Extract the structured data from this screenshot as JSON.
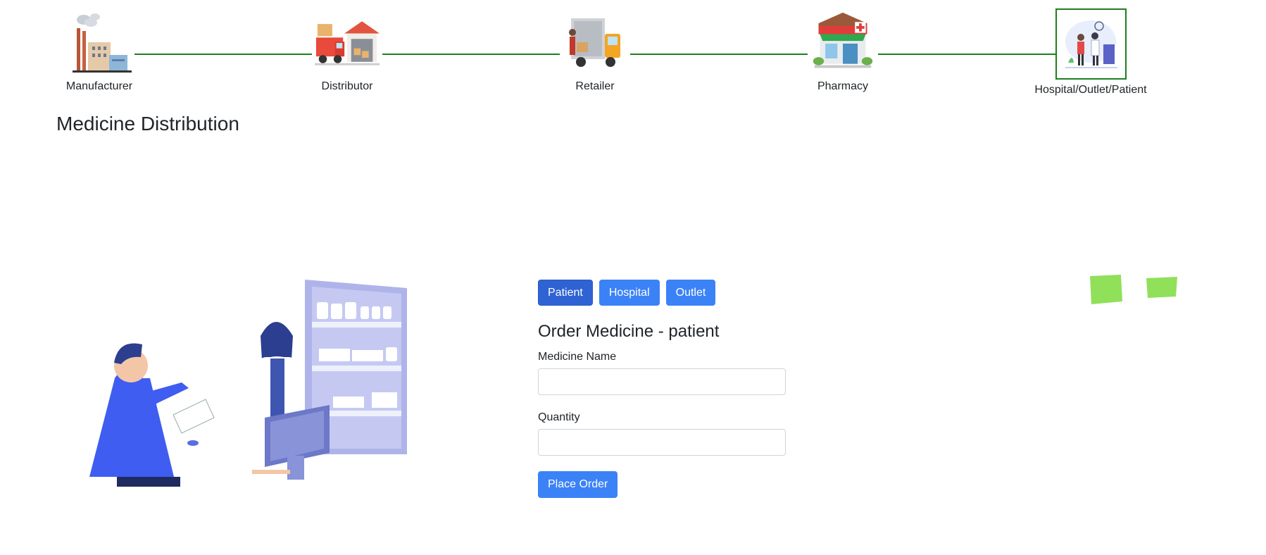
{
  "stepper": {
    "steps": [
      {
        "label": "Manufacturer",
        "icon": "factory-icon"
      },
      {
        "label": "Distributor",
        "icon": "warehouse-truck-icon"
      },
      {
        "label": "Retailer",
        "icon": "delivery-van-icon"
      },
      {
        "label": "Pharmacy",
        "icon": "pharmacy-store-icon"
      },
      {
        "label": "Hospital/Outlet/Patient",
        "icon": "hospital-patient-icon"
      }
    ],
    "active_index": 4,
    "line_color": "#1e7e1e"
  },
  "page": {
    "title": "Medicine Distribution"
  },
  "tabs": [
    {
      "label": "Patient",
      "active": true
    },
    {
      "label": "Hospital",
      "active": false
    },
    {
      "label": "Outlet",
      "active": false
    }
  ],
  "form": {
    "title": "Order Medicine - patient",
    "medicine_name": {
      "label": "Medicine Name",
      "value": "",
      "placeholder": ""
    },
    "quantity": {
      "label": "Quantity",
      "value": "",
      "placeholder": ""
    },
    "submit_label": "Place Order"
  },
  "colors": {
    "primary": "#3b82f6",
    "primary_active": "#2f63d4",
    "accent_green": "#1e7e1e",
    "blob_green": "#90e05a"
  }
}
